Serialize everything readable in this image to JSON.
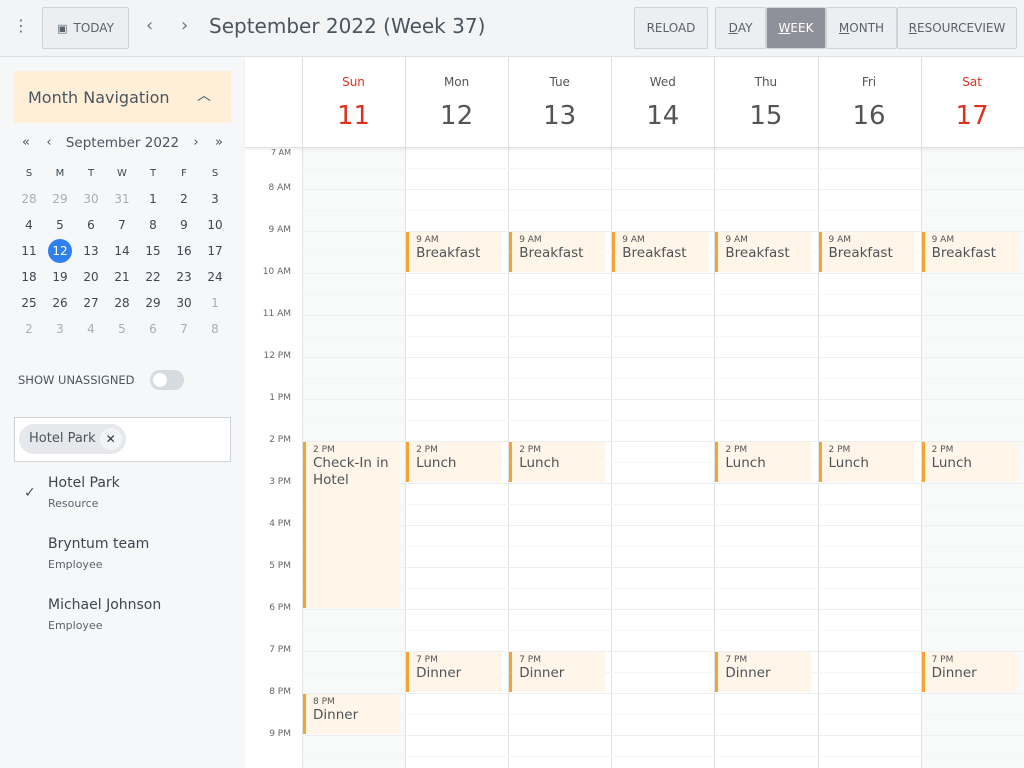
{
  "toolbar": {
    "menu_icon": "vertical-dots-icon",
    "today": "TODAY",
    "today_icon": "calendar-icon",
    "title": "September 2022 (Week 37)",
    "reload": "RELOAD",
    "views": [
      {
        "first": "D",
        "rest": "AY",
        "active": false
      },
      {
        "first": "W",
        "rest": "EEK",
        "active": true
      },
      {
        "first": "M",
        "rest": "ONTH",
        "active": false
      },
      {
        "first": "R",
        "rest": "ESOURCEVIEW",
        "active": false
      }
    ]
  },
  "sidebar": {
    "month_nav_title": "Month Navigation",
    "mini": {
      "title": "September 2022",
      "weekdays": [
        "S",
        "M",
        "T",
        "W",
        "T",
        "F",
        "S"
      ],
      "weeks": [
        [
          28,
          29,
          30,
          31,
          1,
          2,
          3
        ],
        [
          4,
          5,
          6,
          7,
          8,
          9,
          10
        ],
        [
          11,
          12,
          13,
          14,
          15,
          16,
          17
        ],
        [
          18,
          19,
          20,
          21,
          22,
          23,
          24
        ],
        [
          25,
          26,
          27,
          28,
          29,
          30,
          1
        ],
        [
          2,
          3,
          4,
          5,
          6,
          7,
          8
        ]
      ],
      "today": 12
    },
    "show_unassigned": "SHOW UNASSIGNED",
    "show_unassigned_on": false,
    "chip": "Hotel Park",
    "resources": [
      {
        "name": "Hotel Park",
        "type": "Resource",
        "checked": true
      },
      {
        "name": "Bryntum team",
        "type": "Employee",
        "checked": false
      },
      {
        "name": "Michael Johnson",
        "type": "Employee",
        "checked": false
      }
    ]
  },
  "calendar": {
    "days": [
      {
        "name": "Sun",
        "date": "11",
        "weekend": true
      },
      {
        "name": "Mon",
        "date": "12"
      },
      {
        "name": "Tue",
        "date": "13"
      },
      {
        "name": "Wed",
        "date": "14"
      },
      {
        "name": "Thu",
        "date": "15"
      },
      {
        "name": "Fri",
        "date": "16"
      },
      {
        "name": "Sat",
        "date": "17",
        "weekend": true
      }
    ],
    "hours": [
      "7 AM",
      "8 AM",
      "9 AM",
      "10 AM",
      "11 AM",
      "12 PM",
      "1 PM",
      "2 PM",
      "3 PM",
      "4 PM",
      "5 PM",
      "6 PM",
      "7 PM",
      "8 PM",
      "9 PM"
    ],
    "events": [
      {
        "day": 1,
        "start": 9,
        "end": 10,
        "time": "9 AM",
        "title": "Breakfast"
      },
      {
        "day": 2,
        "start": 9,
        "end": 10,
        "time": "9 AM",
        "title": "Breakfast"
      },
      {
        "day": 3,
        "start": 9,
        "end": 10,
        "time": "9 AM",
        "title": "Breakfast"
      },
      {
        "day": 4,
        "start": 9,
        "end": 10,
        "time": "9 AM",
        "title": "Breakfast"
      },
      {
        "day": 5,
        "start": 9,
        "end": 10,
        "time": "9 AM",
        "title": "Breakfast"
      },
      {
        "day": 6,
        "start": 9,
        "end": 10,
        "time": "9 AM",
        "title": "Breakfast"
      },
      {
        "day": 0,
        "start": 14,
        "end": 18,
        "time": "2 PM",
        "title": "Check-In in Hotel"
      },
      {
        "day": 1,
        "start": 14,
        "end": 15,
        "time": "2 PM",
        "title": "Lunch"
      },
      {
        "day": 2,
        "start": 14,
        "end": 15,
        "time": "2 PM",
        "title": "Lunch"
      },
      {
        "day": 4,
        "start": 14,
        "end": 15,
        "time": "2 PM",
        "title": "Lunch"
      },
      {
        "day": 5,
        "start": 14,
        "end": 15,
        "time": "2 PM",
        "title": "Lunch"
      },
      {
        "day": 6,
        "start": 14,
        "end": 15,
        "time": "2 PM",
        "title": "Lunch"
      },
      {
        "day": 1,
        "start": 19,
        "end": 20,
        "time": "7 PM",
        "title": "Dinner"
      },
      {
        "day": 2,
        "start": 19,
        "end": 20,
        "time": "7 PM",
        "title": "Dinner"
      },
      {
        "day": 4,
        "start": 19,
        "end": 20,
        "time": "7 PM",
        "title": "Dinner"
      },
      {
        "day": 6,
        "start": 19,
        "end": 20,
        "time": "7 PM",
        "title": "Dinner"
      },
      {
        "day": 0,
        "start": 20,
        "end": 21,
        "time": "8 PM",
        "title": "Dinner"
      }
    ]
  },
  "colors": {
    "accent": "#f5a332",
    "event_bg": "#fff5e8",
    "weekend_red": "#e0301e",
    "today_blue": "#2f80ed",
    "active_view": "#8f9099",
    "month_nav_bg": "#ffefd9"
  }
}
